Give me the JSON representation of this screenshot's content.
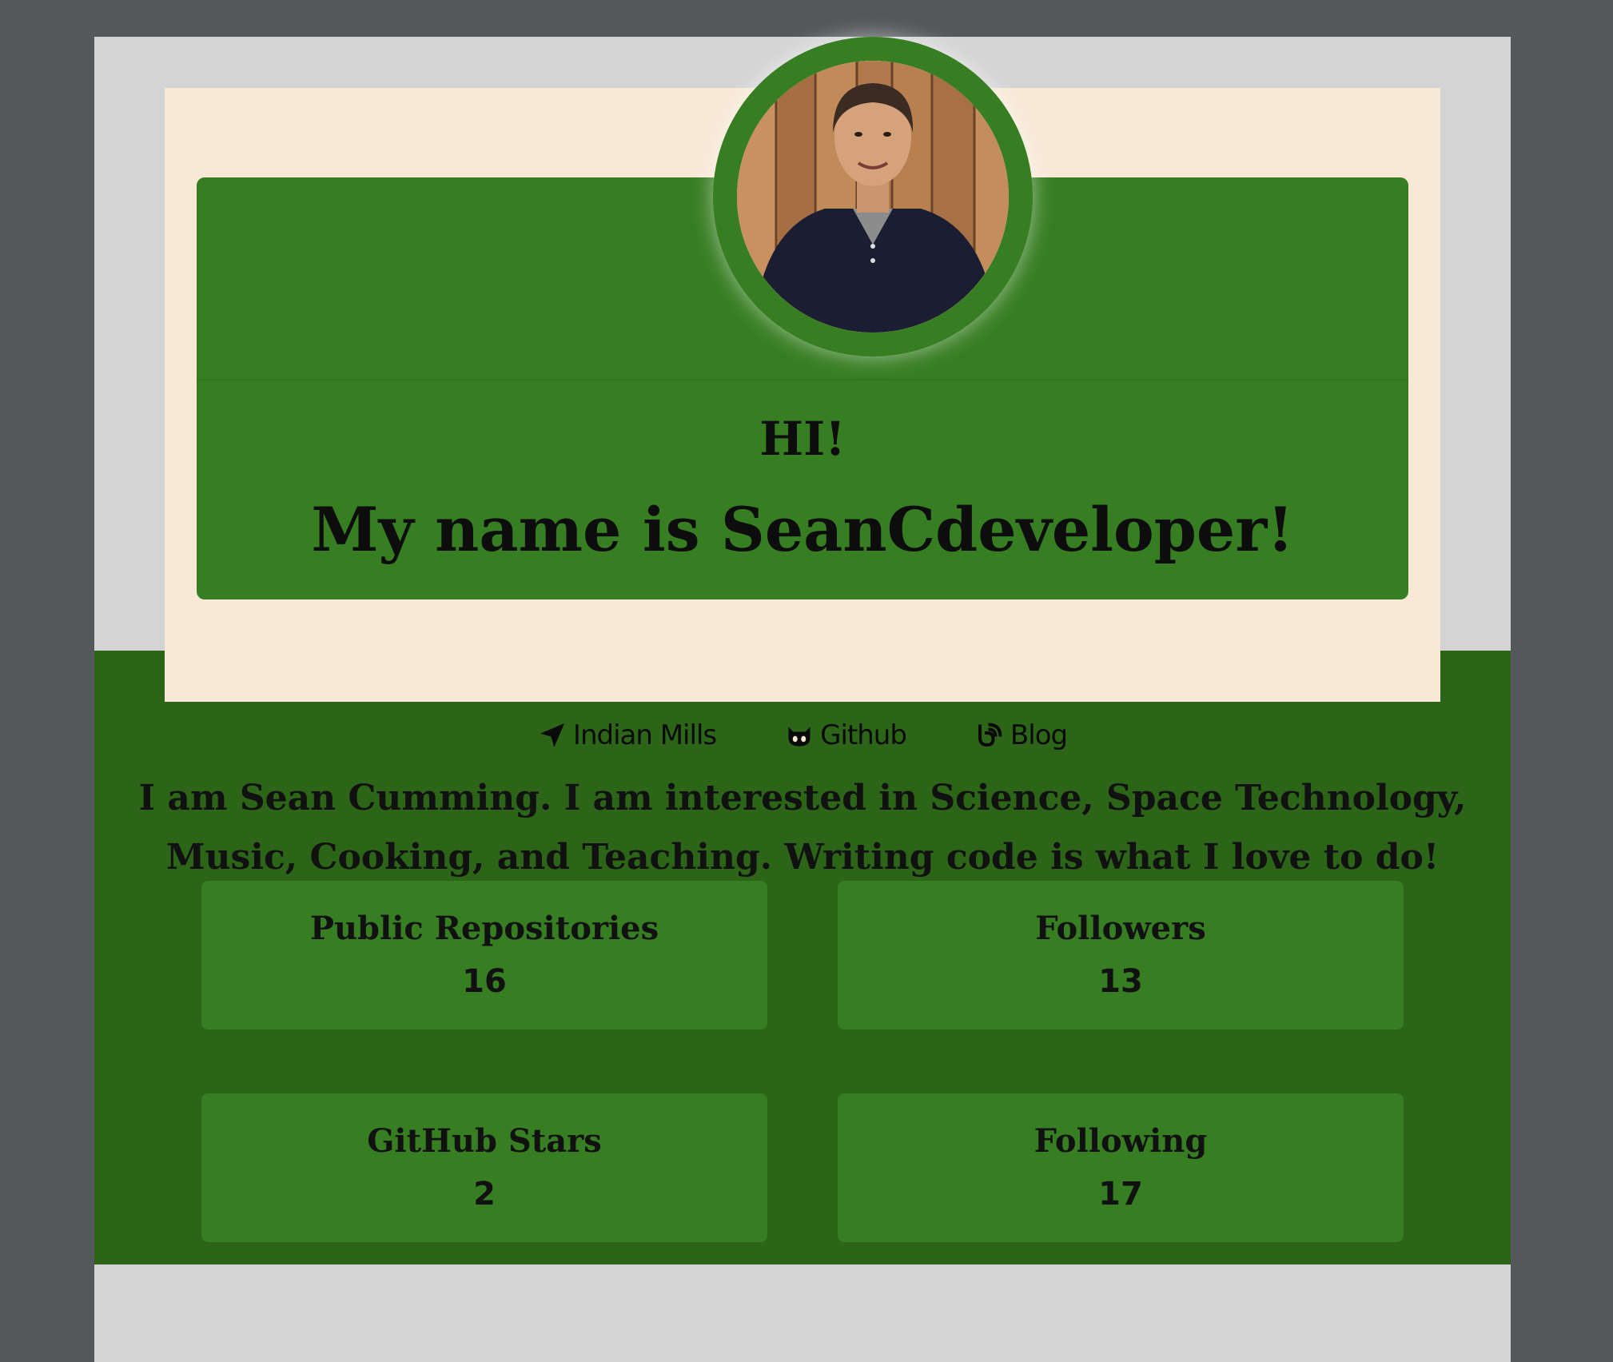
{
  "header": {
    "greeting": "HI!",
    "name_line": "My name is SeanCdeveloper!"
  },
  "links": [
    {
      "label": "Indian Mills",
      "icon": "location-arrow-icon"
    },
    {
      "label": "Github",
      "icon": "github-icon"
    },
    {
      "label": "Blog",
      "icon": "rss-icon"
    }
  ],
  "bio": "I am Sean Cumming. I am interested in Science, Space Technology, Music, Cooking, and Teaching. Writing code is what I love to do!",
  "stats": [
    {
      "label": "Public Repositories",
      "value": "16"
    },
    {
      "label": "Followers",
      "value": "13"
    },
    {
      "label": "GitHub Stars",
      "value": "2"
    },
    {
      "label": "Following",
      "value": "17"
    }
  ],
  "colors": {
    "page_background": "#54585b",
    "wrapper": "#d4d4d4",
    "card": "#f8e9d7",
    "accent_green": "#377e22",
    "dark_green": "#2c6418"
  }
}
